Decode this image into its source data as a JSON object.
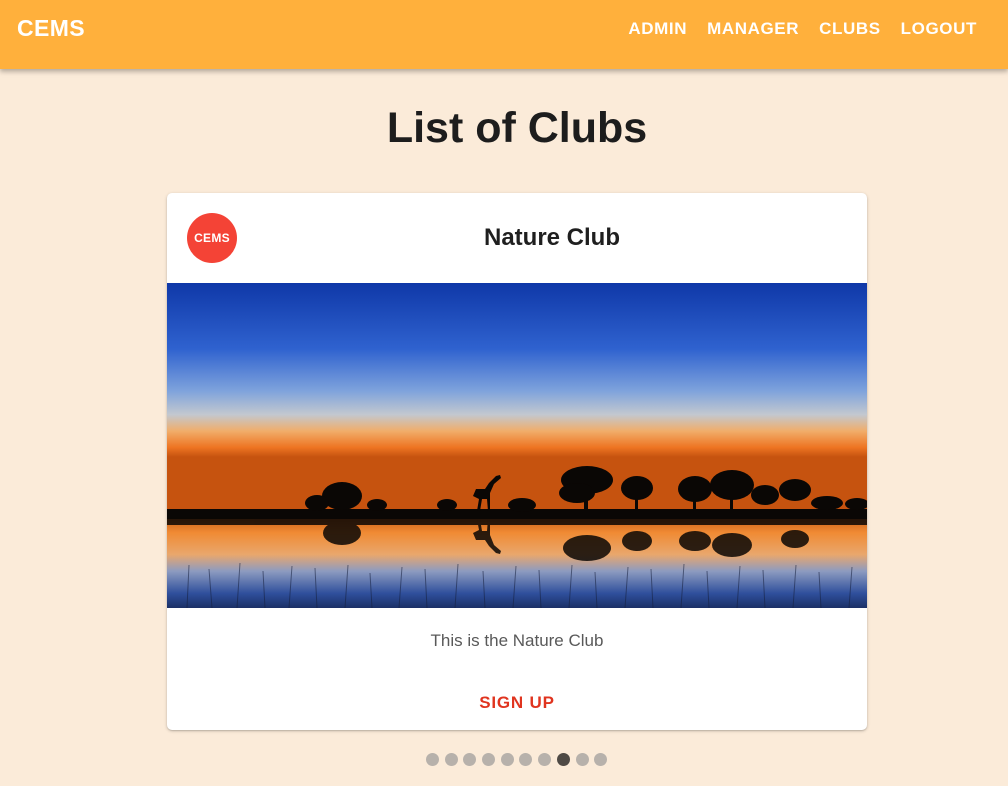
{
  "appbar": {
    "brand": "CEMS",
    "nav": [
      {
        "label": "ADMIN"
      },
      {
        "label": "MANAGER"
      },
      {
        "label": "CLUBS"
      },
      {
        "label": "LOGOUT"
      }
    ]
  },
  "page": {
    "title": "List of Clubs"
  },
  "card": {
    "avatar_text": "CEMS",
    "title": "Nature Club",
    "description": "This is the Nature Club",
    "action_label": "SIGN UP",
    "image_icon": "savanna-sunset-giraffe-image"
  },
  "carousel": {
    "total": 10,
    "active_index": 7
  },
  "colors": {
    "appbar": "#ffb03c",
    "background": "#fbebd9",
    "avatar": "#f44336",
    "action": "#e0341f",
    "dot": "#b7b1ab",
    "dot_active": "#4f4a45"
  }
}
